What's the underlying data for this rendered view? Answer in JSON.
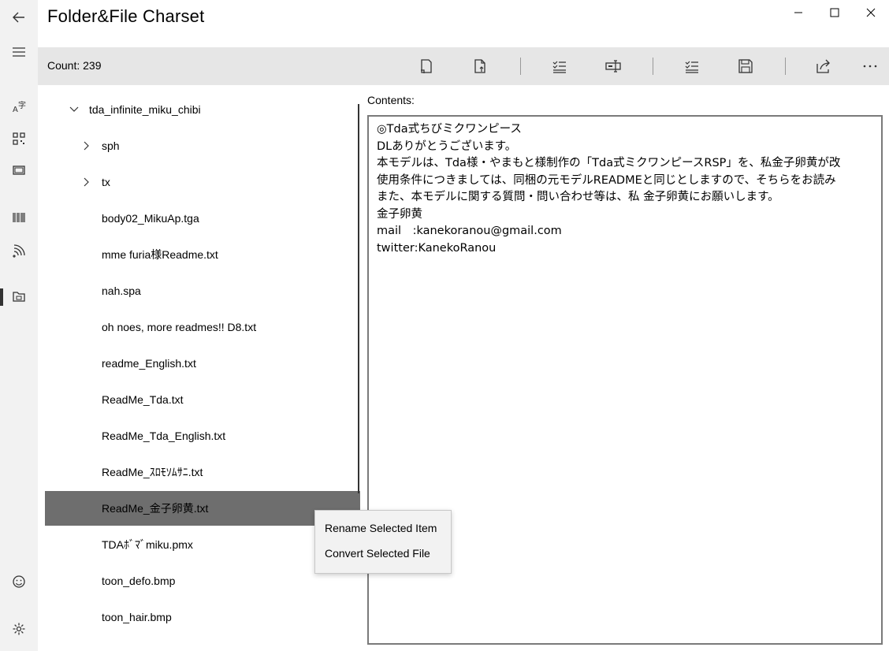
{
  "app": {
    "title": "Folder&File Charset"
  },
  "window_controls": [
    "minimize-icon",
    "maximize-icon",
    "close-icon"
  ],
  "nav": {
    "back": "back-arrow-icon",
    "menu": "hamburger-icon",
    "items": [
      "charset-icon",
      "qr-code-icon",
      "hardware-icon",
      "barcode-icon",
      "nfc-icon",
      "folder-file-icon"
    ],
    "bottom": [
      "feedback-icon",
      "settings-icon"
    ]
  },
  "commandbar": {
    "count": "Count: 239",
    "buttons": [
      "open-folder-icon",
      "open-file-icon",
      "select-all-icon",
      "rename-icon",
      "convert-icon",
      "save-icon",
      "share-icon",
      "more-icon"
    ]
  },
  "tree": {
    "root": "tda_infinite_miku_chibi",
    "folders": [
      "sph",
      "tx"
    ],
    "files": [
      "body02_MikuAp.tga",
      "mme furia様Readme.txt",
      "nah.spa",
      "oh noes, more readmes!! D8.txt",
      "readme_English.txt",
      "ReadMe_Tda.txt",
      "ReadMe_Tda_English.txt",
      "ReadMe_ｽﾛﾓｿﾑｻﾆ.txt",
      "ReadMe_金子卵黄.txt",
      "TDAﾎﾞﾏﾞmiku.pmx",
      "toon_defo.bmp",
      "toon_hair.bmp"
    ],
    "selected": "ReadMe_金子卵黄.txt"
  },
  "contents": {
    "label": "Contents:",
    "lines": [
      "◎Tda式ちびミクワンピース",
      "",
      "",
      "DLありがとうございます。",
      "本モデルは、Tda様・やまもと様制作の「Tda式ミクワンピースRSP」を、私金子卵黄が改",
      "",
      "使用条件につきましては、同梱の元モデルREADMEと同じとしますので、そちらをお読み",
      "また、本モデルに関する質問・問い合わせ等は、私 金子卵黄にお願いします。",
      "",
      "",
      "金子卵黄",
      "mail　:kanekoranou@gmail.com",
      "twitter:KanekoRanou"
    ]
  },
  "context_menu": {
    "items": [
      "Rename Selected Item",
      "Convert Selected File"
    ]
  }
}
